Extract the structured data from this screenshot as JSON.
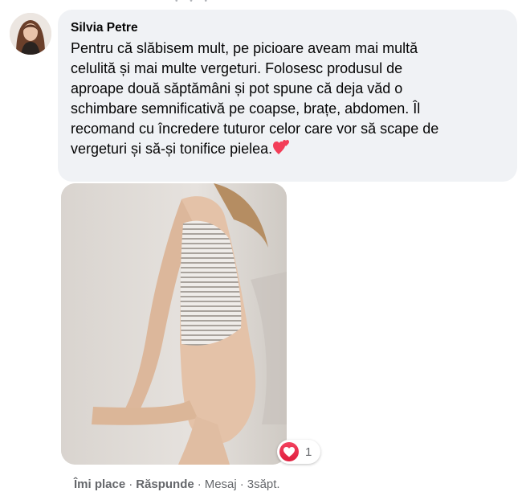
{
  "comment": {
    "author": "Silvia Petre",
    "text_lines": [
      "Pentru că slăbisem mult, pe picioare aveam mai multă",
      "celulită și mai multe vergeturi. Folosesc produsul de",
      "aproape două săptămâni și pot spune că deja văd o",
      "schimbare semnificativă pe coapse, brațe, abdomen. Îl",
      "recomand cu încredere tuturor celor care vor să scape de",
      "vergeturi și să-și tonifice pielea."
    ],
    "emoji": "two-hearts-icon"
  },
  "reactions": {
    "icon": "heart-reaction-icon",
    "count": "1"
  },
  "actions": {
    "like": "Îmi place",
    "reply": "Răspunde",
    "message": "Mesaj",
    "time": "3săpt.",
    "separator": "·"
  },
  "colors": {
    "bubble": "#f0f2f5",
    "secondary_text": "#65676b",
    "heart": "#f33e58"
  }
}
